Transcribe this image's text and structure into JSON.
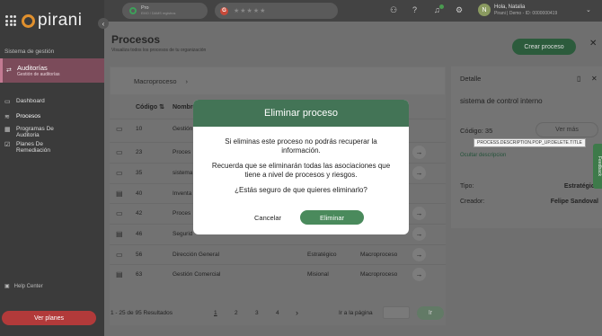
{
  "sidebar": {
    "brand": "pirani",
    "section_label": "Sistema de gestión",
    "module": {
      "name": "Auditorías",
      "subtitle": "Gestión de auditorías"
    },
    "nav": [
      {
        "label": "Dashboard",
        "icon": "monitor-icon"
      },
      {
        "label": "Procesos",
        "icon": "layers-icon"
      },
      {
        "label": "Programas De Auditoria",
        "icon": "calendar-icon"
      },
      {
        "label": "Planes De Remediación",
        "icon": "checkbox-icon"
      }
    ],
    "help": "Help Center",
    "plans_button": "Ver planes"
  },
  "topbar": {
    "plan": {
      "name": "Pro",
      "detail": "EMO / DAMS registros"
    },
    "rating_stars": "★★★★★",
    "user": {
      "name": "Hola, Natalia",
      "detail": "Pirani | Demo - ID: 0000000419",
      "initial": "N"
    }
  },
  "page": {
    "title": "Procesos",
    "subtitle": "Visualiza todos los procesos de tu organización",
    "create_button": "Crear proceso",
    "close": "✕"
  },
  "table": {
    "breadcrumb": "Macroproceso",
    "headers": {
      "code": "Código",
      "name": "Nombre"
    },
    "rows": [
      {
        "code": "10",
        "name": "Gestión",
        "type": "",
        "category": ""
      },
      {
        "code": "23",
        "name": "Proces",
        "type": "",
        "category": ""
      },
      {
        "code": "35",
        "name": "sistema",
        "type": "",
        "category": ""
      },
      {
        "code": "40",
        "name": "Inventa",
        "type": "",
        "category": ""
      },
      {
        "code": "42",
        "name": "Proces",
        "type": "",
        "category": ""
      },
      {
        "code": "46",
        "name": "Segurid",
        "type": "",
        "category": ""
      },
      {
        "code": "56",
        "name": "Dirección General",
        "type": "Estratégico",
        "category": "Macroproceso"
      },
      {
        "code": "63",
        "name": "Gestión Comercial",
        "type": "Misional",
        "category": "Macroproceso"
      }
    ],
    "results": "1 - 25 de 95 Resultados",
    "pages": [
      "1",
      "2",
      "3",
      "4"
    ],
    "goto_label": "Ir a la página",
    "goto_button": "Ir"
  },
  "detail": {
    "title": "Detalle",
    "name": "sistema de control interno",
    "code": "Código: 35",
    "more_button": "Ver más",
    "tooltip": "PROCESS.DESCRIPTION.POP_UP.DELETE.TITLE",
    "hide_description": "Ocultar descripcion",
    "type_label": "Tipo:",
    "type_value": "Estratégico",
    "creator_label": "Creador:",
    "creator_value": "Felipe Sandoval"
  },
  "feedback_tab": "Feedback",
  "modal": {
    "title": "Eliminar proceso",
    "line1": "Si eliminas este proceso no podrás recuperar la información.",
    "line2": "Recuerda que se eliminarán todas las asociaciones que tiene a nivel de procesos y riesgos.",
    "line3": "¿Estás seguro de que quieres eliminarlo?",
    "cancel": "Cancelar",
    "confirm": "Eliminar"
  },
  "colors": {
    "primary": "#437456",
    "overlay_sidebar": "#3b3b3b",
    "danger": "#b23a3a"
  }
}
